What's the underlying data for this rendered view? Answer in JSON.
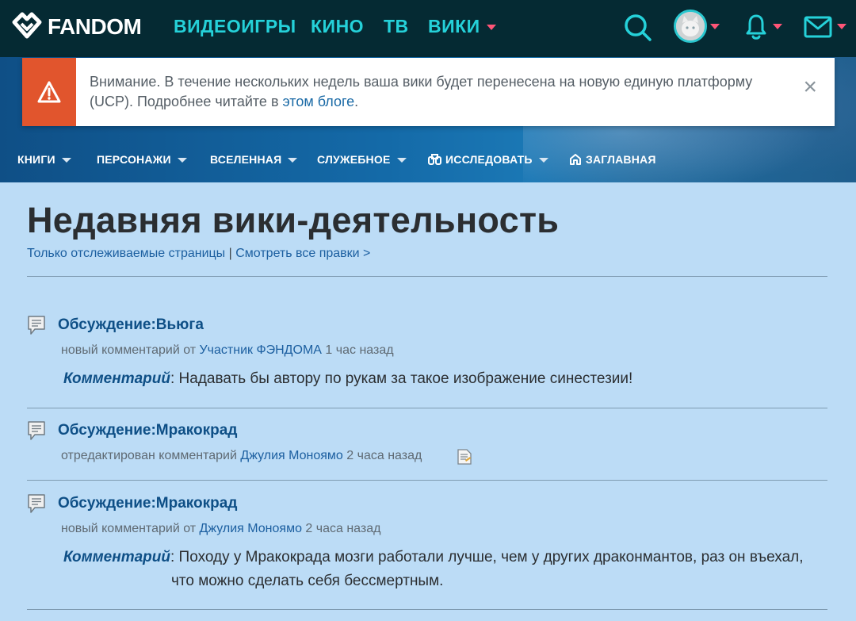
{
  "topnav": {
    "logo_text": "FANDOM",
    "links": [
      "ВИДЕОИГРЫ",
      "КИНО",
      "ТВ",
      "ВИКИ"
    ]
  },
  "banner": {
    "text_before": "Внимание. В течение нескольких недель ваша вики будет перенесена на новую единую платформу (UCP). Подробнее читайте в ",
    "link_text": "этом блоге",
    "text_after": ".",
    "close": "×"
  },
  "localnav": {
    "items": [
      "КНИГИ",
      "ПЕРСОНАЖИ",
      "ВСЕЛЕННАЯ",
      "СЛУЖЕБНОЕ",
      "ИССЛЕДОВАТЬ",
      "ЗАГЛАВНАЯ"
    ]
  },
  "page": {
    "title": "Недавняя вики-деятельность",
    "watched_link": "Только отслеживаемые страницы",
    "separator": " | ",
    "all_edits_link": "Смотреть все правки >"
  },
  "entries": [
    {
      "title": "Обсуждение:Вьюга",
      "action": "новый комментарий от ",
      "user": "Участник ФЭНДОМА",
      "time": " 1 час назад",
      "comment_label": "Комментарий",
      "comment_text": ": Надавать бы автору по рукам за такое изображение синестезии!",
      "comment_text_2": ""
    },
    {
      "title": "Обсуждение:Мракокрад",
      "action": "отредактирован комментарий ",
      "user": "Джулия Моноямо",
      "time": " 2 часа назад"
    },
    {
      "title": "Обсуждение:Мракокрад",
      "action": "новый комментарий от ",
      "user": "Джулия Моноямо",
      "time": " 2 часа назад",
      "comment_label": "Комментарий",
      "comment_text": ": Походу у Мракокрада мозги работали лучше, чем у других драконмантов, раз он въехал,",
      "comment_text_2": "что можно сделать себя бессмертным."
    }
  ],
  "colors": {
    "topnav_bg": "#052a33",
    "accent": "#25d1d9",
    "caret": "#ff5577",
    "content_bg": "#bcdcf6",
    "link": "#1c5fa0",
    "warning": "#e1552d"
  }
}
